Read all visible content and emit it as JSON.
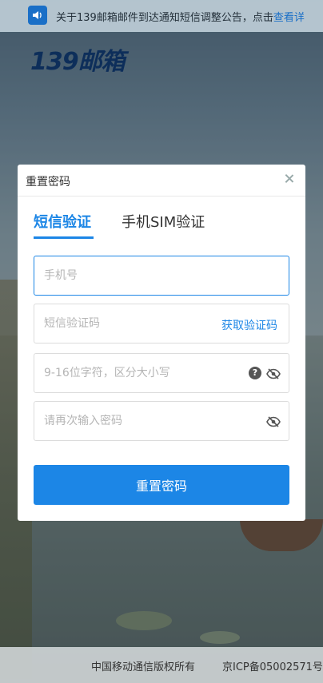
{
  "notice": {
    "icon": "speaker-icon",
    "text": "关于139邮箱邮件到达通知短信调整公告，点击",
    "link": "查看详"
  },
  "logo": {
    "text": "139邮箱"
  },
  "modal": {
    "title": "重置密码",
    "tabs": [
      {
        "label": "短信验证",
        "active": true
      },
      {
        "label": "手机SIM验证",
        "active": false
      }
    ],
    "phone": {
      "placeholder": "手机号",
      "value": ""
    },
    "sms_code": {
      "placeholder": "短信验证码",
      "value": "",
      "action": "获取验证码"
    },
    "password": {
      "placeholder": "9-16位字符，区分大小写",
      "value": "",
      "help": "?"
    },
    "confirm": {
      "placeholder": "请再次输入密码",
      "value": ""
    },
    "submit_label": "重置密码"
  },
  "footer": {
    "copyright": "中国移动通信版权所有",
    "icp": "京ICP备05002571号"
  },
  "colors": {
    "accent": "#1c86e6",
    "logo": "#0d2e5a"
  }
}
